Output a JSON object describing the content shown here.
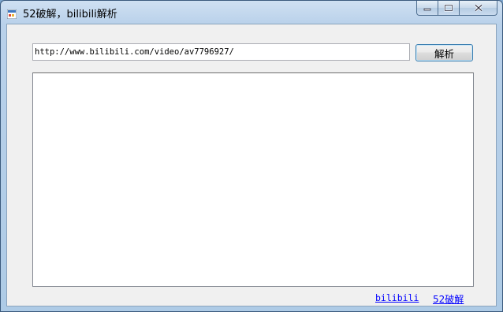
{
  "window": {
    "title": "52破解，bilibili解析",
    "app_icon": "window-app-icon",
    "controls": [
      "minimize-icon",
      "restore-icon",
      "close-icon"
    ]
  },
  "form": {
    "url_value": "http://www.bilibili.com/video/av7796927/",
    "parse_button_label": "解析",
    "output_text": ""
  },
  "footer": {
    "link_bilibili": "bilibili",
    "link_52pojie": "52破解"
  },
  "colors": {
    "link": "#0000ff",
    "button_border": "#3c7fb1",
    "client_bg": "#f0f0f0"
  }
}
